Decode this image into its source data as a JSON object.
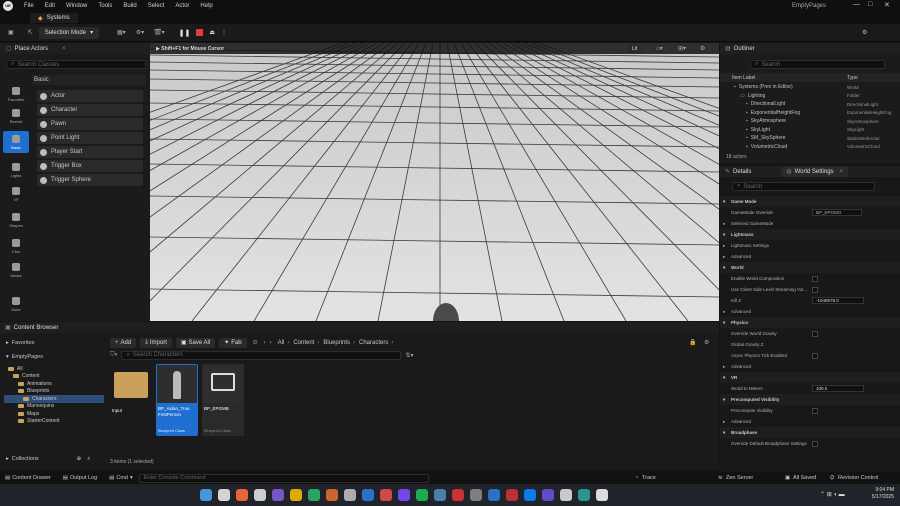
{
  "app": {
    "project_title": "EmptyPages",
    "level_tab": "Systems",
    "logo": "UE"
  },
  "menu": [
    "File",
    "Edit",
    "Window",
    "Tools",
    "Build",
    "Select",
    "Actor",
    "Help"
  ],
  "toolbar": {
    "mode": "Selection Mode"
  },
  "place_actors": {
    "title": "Place Actors",
    "search_placeholder": "Search Classes",
    "section": "Basic",
    "categories": [
      "Favorites",
      "Recent",
      "Basic",
      "Lights",
      "VF",
      "Shapes",
      "Cine",
      "Media",
      "More"
    ],
    "items": [
      "Actor",
      "Character",
      "Pawn",
      "Point Light",
      "Player Start",
      "Trigger Box",
      "Trigger Sphere"
    ]
  },
  "viewport": {
    "hint": "Shift+F1 for Mouse Cursor",
    "view_mode": "Lit"
  },
  "outliner": {
    "title": "Outliner",
    "search_placeholder": "Search",
    "col_label": "Item Label",
    "col_type": "Type",
    "rows": [
      {
        "label": "Systems (Prev in Editor)",
        "type": "World"
      },
      {
        "label": "Lighting",
        "type": "Folder"
      },
      {
        "label": "DirectionalLight",
        "type": "DirectionalLight"
      },
      {
        "label": "ExponentialHeightFog",
        "type": "ExponentialHeightFog"
      },
      {
        "label": "SkyAtmosphere",
        "type": "SkyAtmosphere"
      },
      {
        "label": "SkyLight",
        "type": "SkyLight"
      },
      {
        "label": "SM_SkySphere",
        "type": "StaticMeshActor"
      },
      {
        "label": "VolumetricCloud",
        "type": "VolumetricCloud"
      }
    ],
    "count": "18 actors"
  },
  "details": {
    "tab1": "Details",
    "tab2": "World Settings",
    "search_placeholder": "Search",
    "gamemode_override": "BP_EPGMO",
    "kill_z": "-1048575.0",
    "world_to_meters": "100.0",
    "rows": [
      {
        "kind": "sec",
        "label": "Game Mode"
      },
      {
        "kind": "row",
        "label": "GameMode Override"
      },
      {
        "kind": "row",
        "label": "Selected GameMode"
      },
      {
        "kind": "sec",
        "label": "Lightmass"
      },
      {
        "kind": "row",
        "label": "Lightmass Settings"
      },
      {
        "kind": "row",
        "label": "Advanced"
      },
      {
        "kind": "sec",
        "label": "World"
      },
      {
        "kind": "row",
        "label": "Enable World Composition"
      },
      {
        "kind": "row",
        "label": "Use Client Side Level Streaming Vol..."
      },
      {
        "kind": "row",
        "label": "Kill Z"
      },
      {
        "kind": "row",
        "label": "Advanced"
      },
      {
        "kind": "sec",
        "label": "Physics"
      },
      {
        "kind": "row",
        "label": "Override World Gravity"
      },
      {
        "kind": "row",
        "label": "Global Gravity Z"
      },
      {
        "kind": "row",
        "label": "Async Physics Tick Enabled"
      },
      {
        "kind": "row",
        "label": "Advanced"
      },
      {
        "kind": "sec",
        "label": "VR"
      },
      {
        "kind": "row",
        "label": "World to Meters"
      },
      {
        "kind": "sec",
        "label": "Precomputed Visibility"
      },
      {
        "kind": "row",
        "label": "Precompute Visibility"
      },
      {
        "kind": "row",
        "label": "Advanced"
      },
      {
        "kind": "sec",
        "label": "Broadphase"
      },
      {
        "kind": "row",
        "label": "Override Default Broadphase Settings"
      }
    ]
  },
  "content_browser": {
    "title": "Content Browser",
    "add": "Add",
    "import": "Import",
    "save_all": "Save All",
    "fab": "Fab",
    "path": [
      "All",
      "Content",
      "Blueprints",
      "Characters"
    ],
    "search_placeholder": "Search Characters",
    "favorites": "Favorites",
    "project": "EmptyPages",
    "collections": "Collections",
    "tree": [
      {
        "label": "All",
        "depth": 0
      },
      {
        "label": "Content",
        "depth": 1
      },
      {
        "label": "Animations",
        "depth": 2
      },
      {
        "label": "Blueprints",
        "depth": 2
      },
      {
        "label": "Characters",
        "depth": 3
      },
      {
        "label": "Mannequins",
        "depth": 2
      },
      {
        "label": "Maps",
        "depth": 2
      },
      {
        "label": "StarterContent",
        "depth": 2
      }
    ],
    "assets": [
      {
        "name": "Input",
        "sub": ""
      },
      {
        "name": "BP_Aidan_True FirstPerson",
        "sub": "Blueprint Class"
      },
      {
        "name": "BP_EPGMB",
        "sub": "Blueprint Class"
      }
    ],
    "status": "3 items (1 selected)"
  },
  "statusbar": {
    "content_drawer": "Content Drawer",
    "output_log": "Output Log",
    "cmd": "Cmd",
    "console_placeholder": "Enter Console Command",
    "trace": "Trace",
    "derived": "Zen Server",
    "saved": "All Saved",
    "revision": "Revision Control"
  },
  "taskbar": {
    "time": "9:04 PM",
    "date": "5/17/2025"
  }
}
